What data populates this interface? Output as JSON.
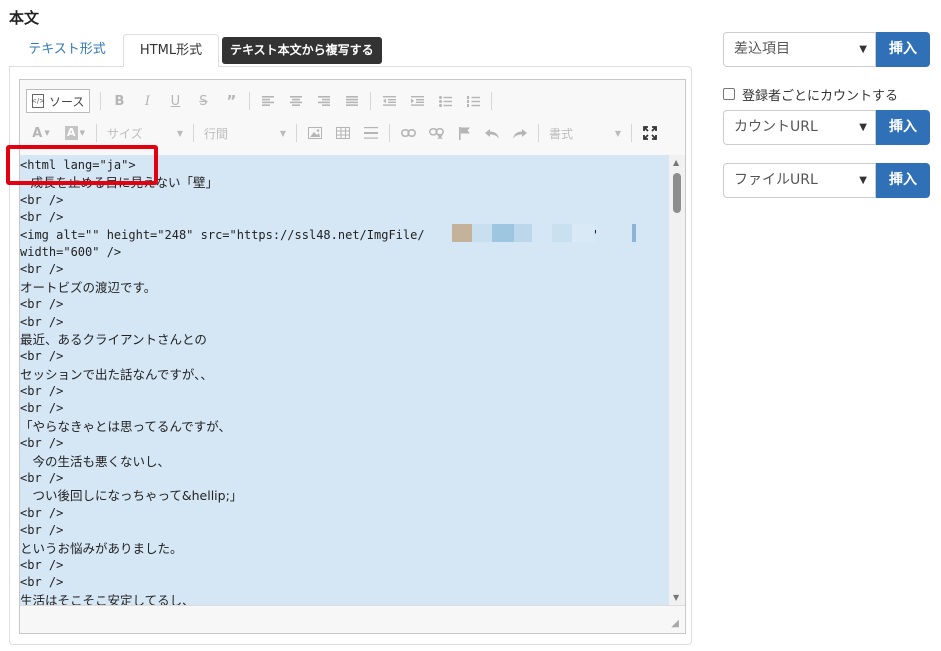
{
  "section": {
    "title": "本文"
  },
  "tabs": [
    {
      "label": "テキスト形式"
    },
    {
      "label": "HTML形式"
    }
  ],
  "copy_button": {
    "label": "テキスト本文から複写する"
  },
  "toolbar": {
    "source_label": "ソース",
    "size_label": "サイズ",
    "line_height_label": "行間",
    "format_label": "書式"
  },
  "code_lines": [
    "<html lang=\"ja\">",
    "=成長を止める目に見えない「壁」",
    "<br />",
    "<br />",
    "<img alt=\"\" height=\"248\" src=\"https://ssl48.net/ImgFile/                    png\"",
    "width=\"600\" />",
    "<br />",
    "オートビズの渡辺です。",
    "<br />",
    "<br />",
    "最近、あるクライアントさんとの",
    "<br />",
    "セッションで出た話なんですが、、",
    "<br />",
    "<br />",
    "「やらなきゃとは思ってるんですが、",
    "<br />",
    "　今の生活も悪くないし、",
    "<br />",
    "　つい後回しになっちゃって&hellip;」",
    "<br />",
    "<br />",
    "というお悩みがありました。",
    "<br />",
    "<br />",
    "生活はそこそこ安定してるし、"
  ],
  "right_panel": {
    "merge_select": "差込項目",
    "count_checkbox_label": "登録者ごとにカウントする",
    "count_url_select": "カウントURL",
    "file_url_select": "ファイルURL",
    "insert_label": "挿入"
  },
  "colors": {
    "accent": "#2f70b7",
    "highlight": "#e3000f",
    "code_bg": "#d5e6f5",
    "tab_link": "#337ab7"
  }
}
